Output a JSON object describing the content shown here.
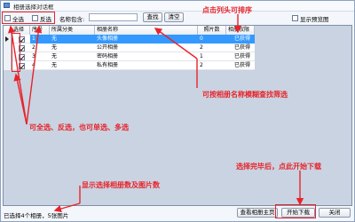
{
  "window": {
    "title": "相册选择对话框"
  },
  "toolbar": {
    "select_all_label": "全选",
    "invert_label": "反选",
    "name_filter_label": "名称包含:",
    "name_filter_value": "",
    "search_label": "查找",
    "clear_label": "清空",
    "thumbnail_label": "显示预览图"
  },
  "table": {
    "headers": [
      "选择",
      "序号",
      "所属分类",
      "相册名称",
      "照片数",
      "相册权限"
    ],
    "rows": [
      {
        "checked": true,
        "index": "1",
        "category": "无",
        "name": "头像相册",
        "photos": "0",
        "permission": "已获得",
        "selected": true
      },
      {
        "checked": true,
        "index": "2",
        "category": "无",
        "name": "公开相册",
        "photos": "2",
        "permission": "已获得",
        "selected": false
      },
      {
        "checked": true,
        "index": "3",
        "category": "无",
        "name": "密码相册",
        "photos": "1",
        "permission": "已获得",
        "selected": false
      },
      {
        "checked": true,
        "index": "4",
        "category": "无",
        "name": "私有相册",
        "photos": "2",
        "permission": "已获得",
        "selected": false
      }
    ]
  },
  "status": {
    "text": "已选择4个相册，5张图片"
  },
  "buttons": {
    "view_home": "查看相册主页",
    "start_download": "开始下载",
    "close": "关闭"
  },
  "annotations": {
    "sort": "点击列头可排序",
    "filter": "可按相册名称模糊查找筛选",
    "select": "可全选、反选，也可单选、多选",
    "count": "显示选择相册数及图片数",
    "download": "选择完毕后，点此开始下载"
  },
  "colors": {
    "annotation": "#e8232a",
    "selection": "#3399ff"
  }
}
